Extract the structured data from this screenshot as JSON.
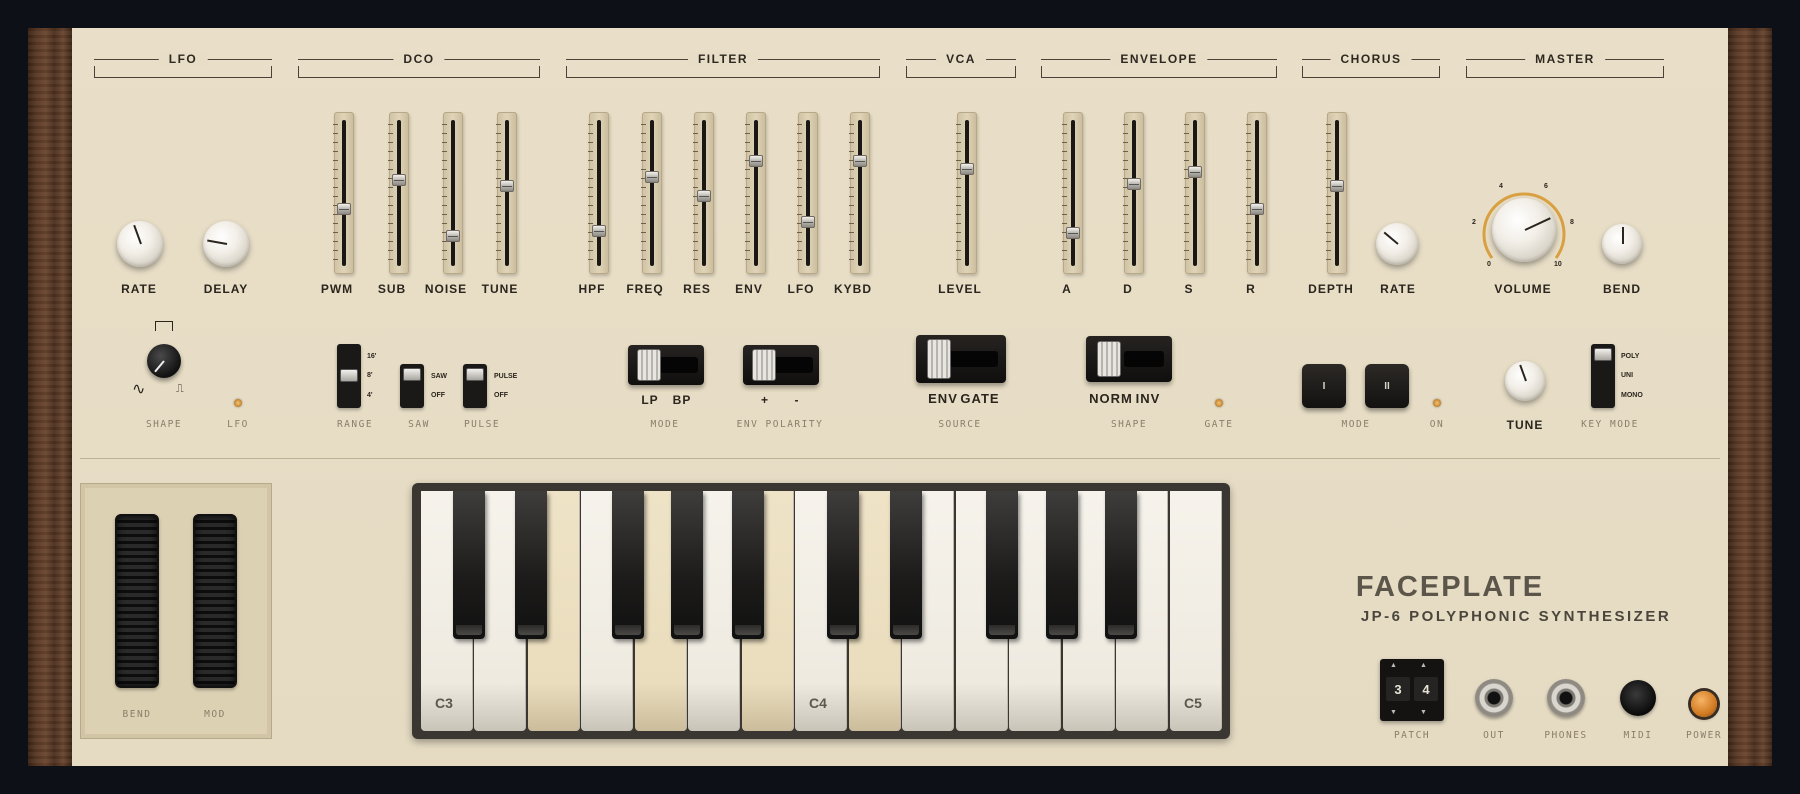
{
  "sections": {
    "lfo": "LFO",
    "dco": "DCO",
    "filter": "FILTER",
    "vca": "VCA",
    "envelope": "ENVELOPE",
    "chorus": "CHORUS",
    "master": "MASTER"
  },
  "lfo": {
    "rate": "RATE",
    "delay": "DELAY",
    "shape": "SHAPE",
    "led": "LFO"
  },
  "dco": {
    "sliders": [
      "PWM",
      "SUB",
      "NOISE",
      "TUNE"
    ],
    "range": "RANGE",
    "range_options": [
      "16'",
      "8'",
      "4'"
    ],
    "saw": "SAW",
    "saw_options": [
      "SAW",
      "OFF"
    ],
    "pulse": "PULSE",
    "pulse_options": [
      "PULSE",
      "OFF"
    ]
  },
  "filter": {
    "sliders": [
      "HPF",
      "FREQ",
      "RES",
      "ENV",
      "LFO",
      "KYBD"
    ],
    "mode": "MODE",
    "mode_options": [
      "LP",
      "BP"
    ],
    "env_polarity": "ENV POLARITY",
    "polarity_options": [
      "+",
      "-"
    ]
  },
  "vca": {
    "level": "LEVEL",
    "source": "SOURCE",
    "source_options": [
      "ENV",
      "GATE"
    ]
  },
  "envelope": {
    "sliders": [
      "A",
      "D",
      "S",
      "R"
    ],
    "shape": "SHAPE",
    "shape_options": [
      "NORM",
      "INV"
    ],
    "gate": "GATE"
  },
  "chorus": {
    "depth": "DEPTH",
    "rate": "RATE",
    "mode": "MODE",
    "on": "ON",
    "btn1": "I",
    "btn2": "II"
  },
  "master": {
    "volume": "VOLUME",
    "bend": "BEND",
    "tune": "TUNE",
    "key_mode": "KEY MODE",
    "key_mode_options": [
      "POLY",
      "UNI",
      "MONO"
    ],
    "volume_scale": [
      "0",
      "2",
      "4",
      "6",
      "8",
      "10"
    ]
  },
  "wheels": {
    "bend": "BEND",
    "mod": "MOD"
  },
  "keyboard": {
    "c3": "C3",
    "c4": "C4",
    "c5": "C5"
  },
  "brand": {
    "name": "FACEPLATE",
    "model": "JP-6 POLYPHONIC SYNTHESIZER"
  },
  "io": {
    "patch": "PATCH",
    "patch_digits": [
      "3",
      "4"
    ],
    "out": "OUT",
    "phones": "PHONES",
    "midi": "MIDI",
    "power": "POWER"
  },
  "slider_levels": {
    "pwm": 0.38,
    "sub": 0.6,
    "noise": 0.18,
    "tune": 0.55,
    "hpf": 0.22,
    "freq": 0.62,
    "res": 0.48,
    "env": 0.74,
    "lfo_amt": 0.28,
    "kybd": 0.74,
    "level": 0.68,
    "a": 0.2,
    "d": 0.57,
    "s": 0.66,
    "r": 0.38,
    "depth": 0.55
  },
  "colors": {
    "panel": "#e8dec7",
    "wood": "#5a3a26",
    "led": "#d28b33",
    "volume_ring": "#d9a042"
  }
}
